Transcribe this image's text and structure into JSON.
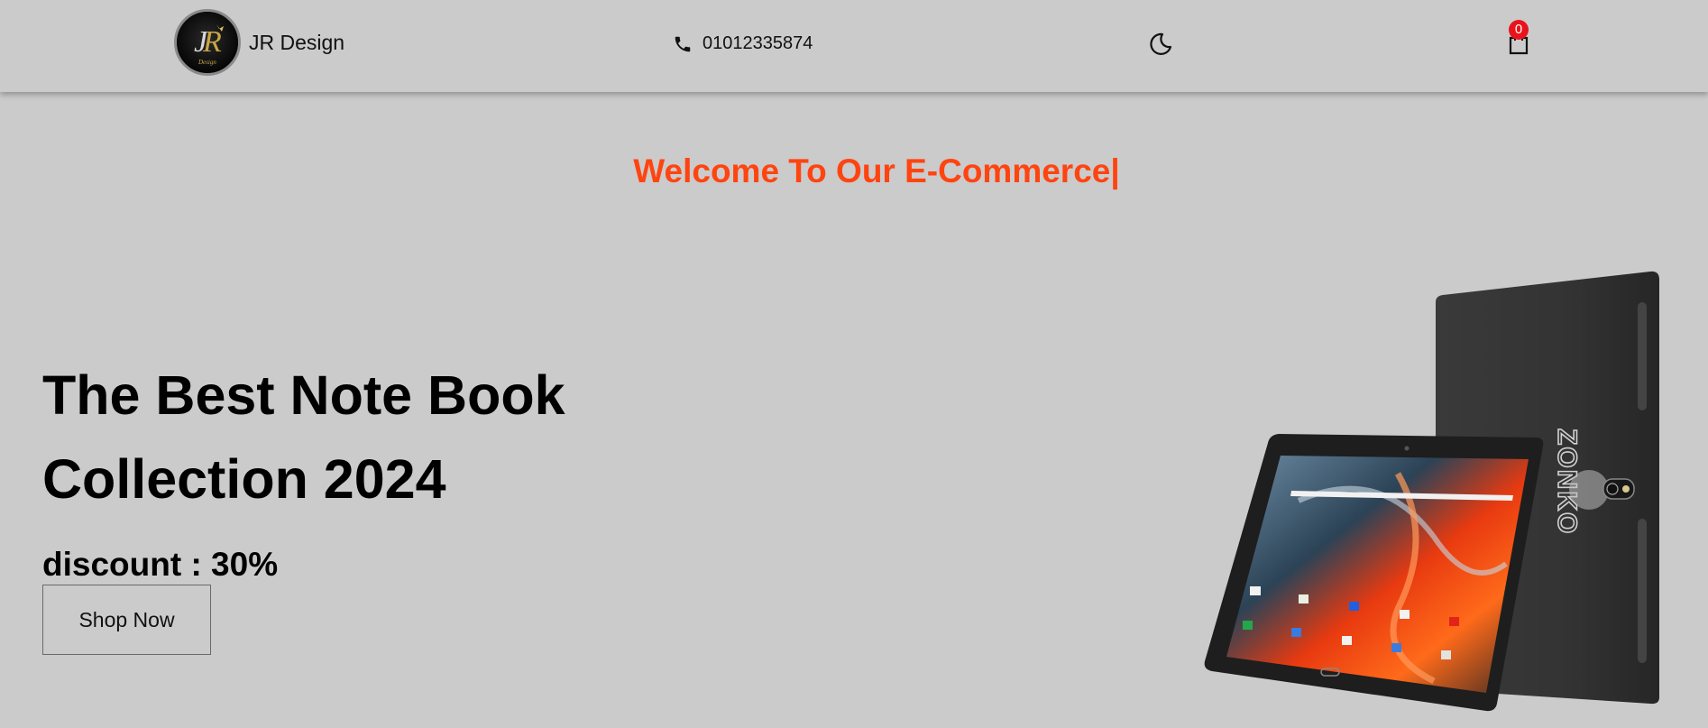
{
  "header": {
    "brand_name": "JR Design",
    "phone_number": "01012335874",
    "theme_icon": "moon-icon",
    "cart_icon": "shopping-bag-icon",
    "cart_count": "0"
  },
  "hero": {
    "welcome_text": "Welcome To Our E-Commerce|",
    "title_line1": "The Best Note Book",
    "title_line2": "Collection 2024",
    "discount_text": "discount : 30%",
    "cta_label": "Shop Now",
    "product_logo_text": "ZONKO"
  },
  "colors": {
    "background": "#cbcbcb",
    "accent": "#ff4410",
    "badge": "#e8141b"
  }
}
